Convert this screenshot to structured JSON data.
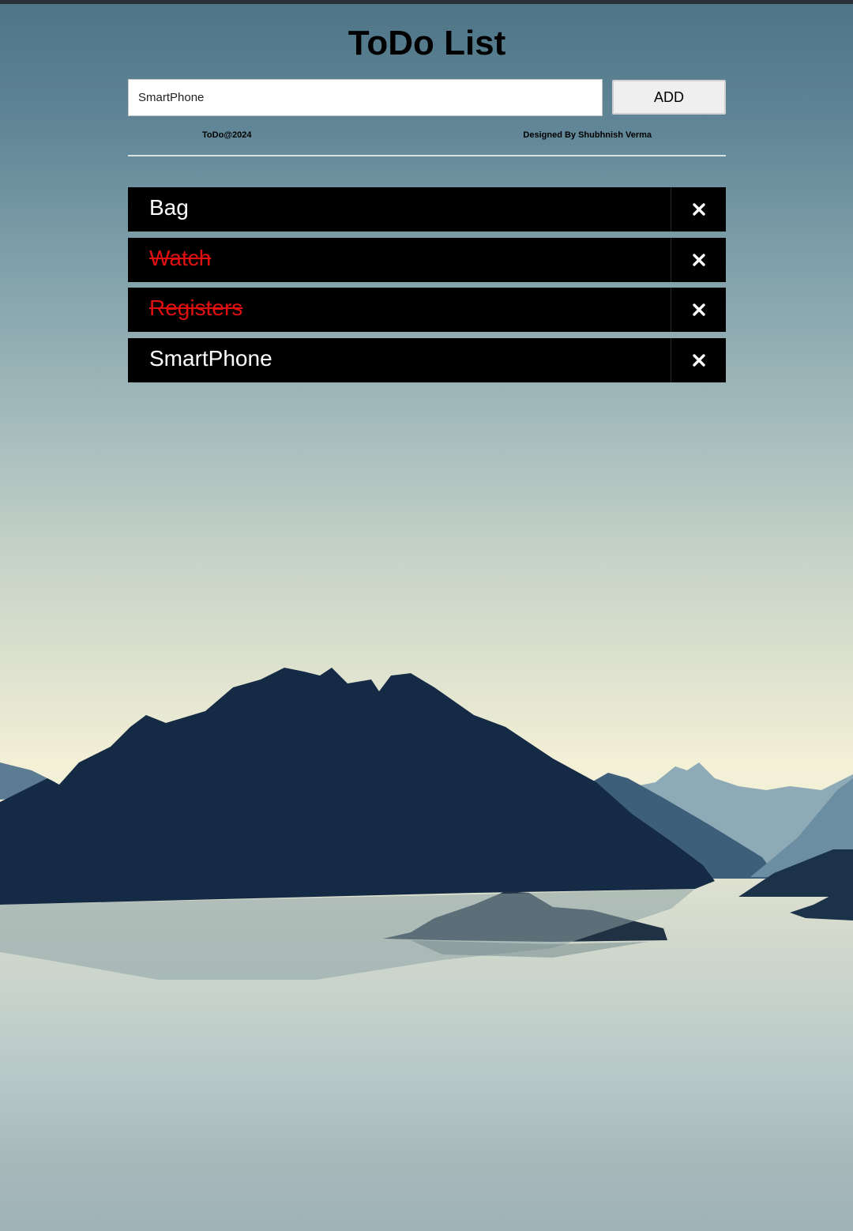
{
  "app": {
    "title": "ToDo List"
  },
  "input": {
    "value": "SmartPhone",
    "add_label": "ADD"
  },
  "footer": {
    "left": "ToDo@2024",
    "right": "Designed By Shubhnish Verma"
  },
  "todos": [
    {
      "text": "Bag",
      "done": false
    },
    {
      "text": "Watch",
      "done": true
    },
    {
      "text": "Registers",
      "done": true
    },
    {
      "text": "SmartPhone",
      "done": false
    }
  ],
  "icons": {
    "delete": "close-icon"
  },
  "colors": {
    "item_bg": "#000000",
    "item_text": "#ffffff",
    "done_text": "#e01010"
  }
}
